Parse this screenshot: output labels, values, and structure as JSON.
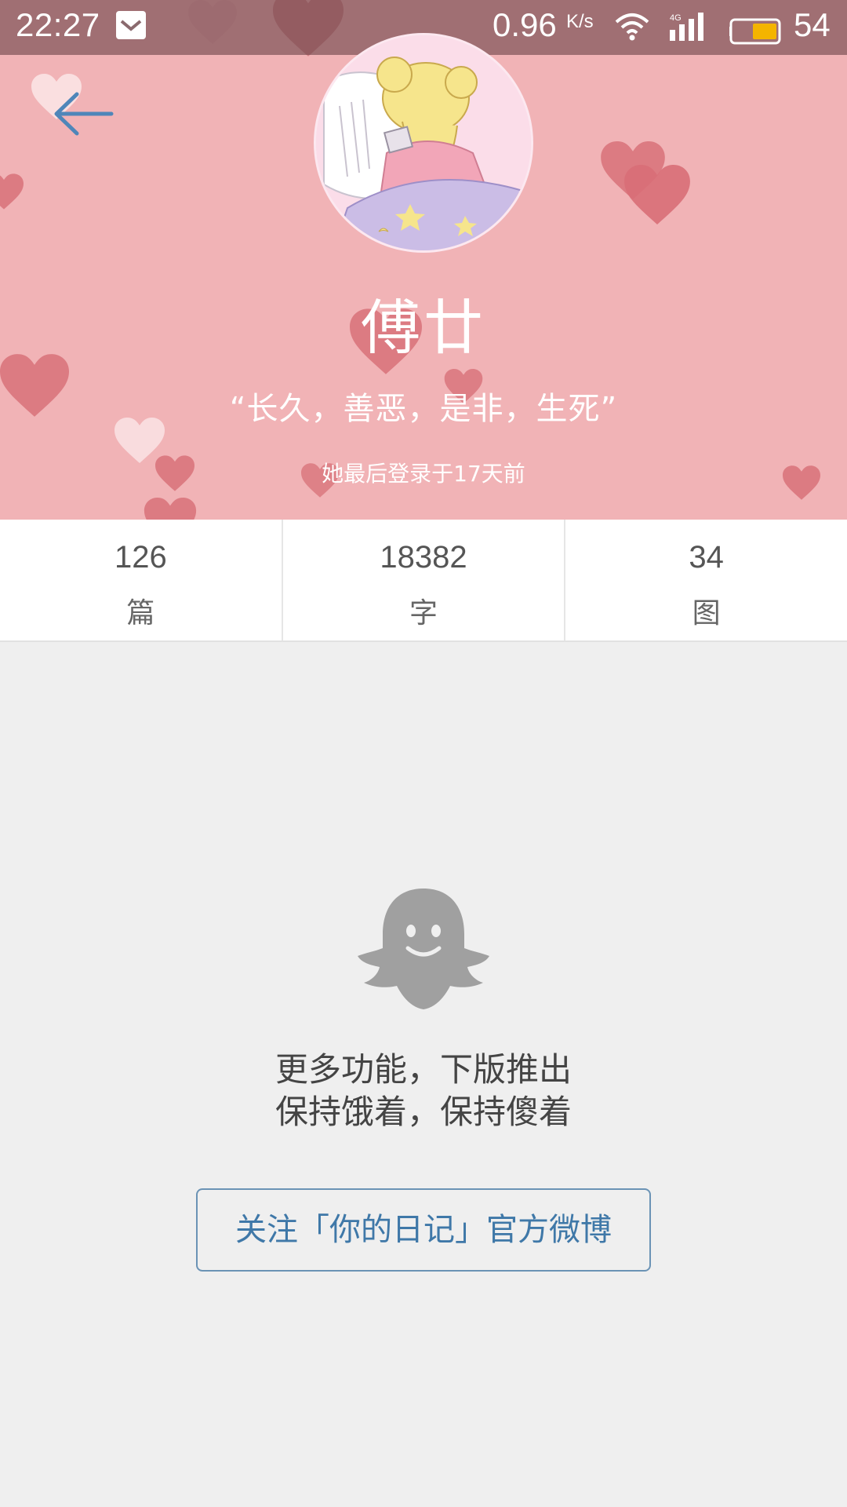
{
  "status_bar": {
    "time": "22:27",
    "network_speed": "0.96",
    "network_speed_unit": "K/s",
    "network_type": "4G",
    "battery_level": "54",
    "icons": [
      "notification-icon",
      "wifi-icon",
      "signal-icon",
      "battery-icon"
    ]
  },
  "header": {
    "back_icon": "arrow-left-icon",
    "username": "傅廿",
    "motto": "“长久，善恶，是非，生死”",
    "last_login": "她最后登录于17天前",
    "background_color": "#f1b3b6",
    "heart_color": "#d9747c"
  },
  "stats": [
    {
      "value": "126",
      "label": "篇"
    },
    {
      "value": "18382",
      "label": "字"
    },
    {
      "value": "34",
      "label": "图"
    }
  ],
  "empty_state": {
    "icon": "ghost-icon",
    "line1": "更多功能，下版推出",
    "line2": "保持饿着，保持傻着"
  },
  "follow_button": {
    "label": "关注「你的日记」官方微博",
    "color": "#3f78a8"
  }
}
